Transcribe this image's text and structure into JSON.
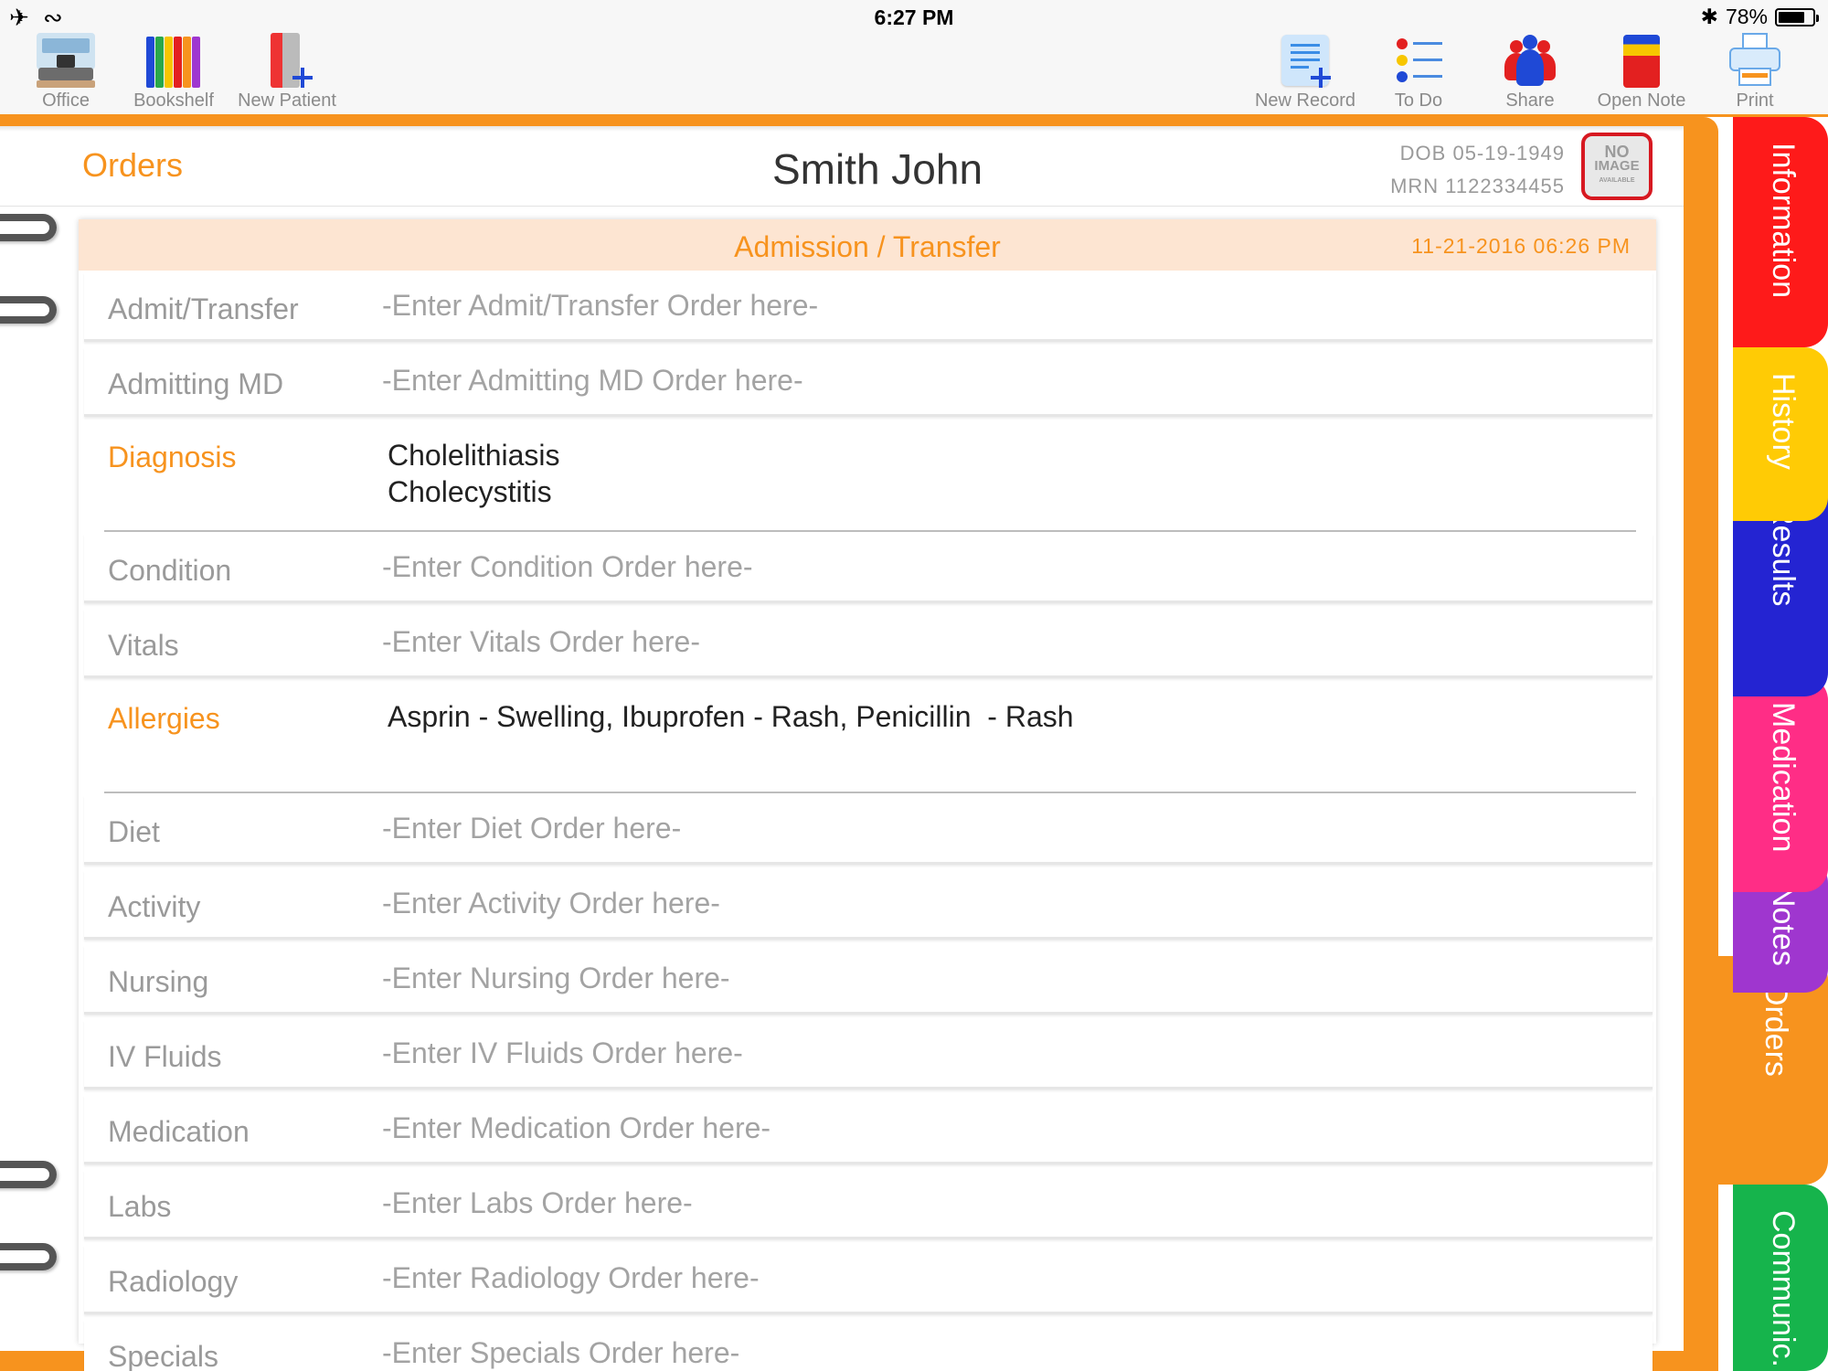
{
  "status_bar": {
    "airplane_icon": "airplane-icon",
    "wifi_icon": "wifi-icon",
    "time": "6:27 PM",
    "bluetooth_icon": "bluetooth-icon",
    "battery": "78%",
    "battery_level": 0.78
  },
  "toolbar": {
    "left": [
      {
        "label": "Office",
        "icon": "office-icon"
      },
      {
        "label": "Bookshelf",
        "icon": "bookshelf-icon"
      },
      {
        "label": "New Patient",
        "icon": "new-patient-icon"
      }
    ],
    "right": [
      {
        "label": "New Record",
        "icon": "new-record-icon"
      },
      {
        "label": "To Do",
        "icon": "todo-list-icon"
      },
      {
        "label": "Share",
        "icon": "share-people-icon"
      },
      {
        "label": "Open Note",
        "icon": "open-note-icon"
      },
      {
        "label": "Print",
        "icon": "printer-icon"
      }
    ]
  },
  "header": {
    "section": "Orders",
    "patient_name": "Smith John",
    "dob": "DOB 05-19-1949",
    "mrn": "MRN 1122334455",
    "photo": {
      "line1": "NO",
      "line2": "IMAGE",
      "line3": "AVAILABLE"
    }
  },
  "form": {
    "title": "Admission / Transfer",
    "date": "11-21-2016 06:26 PM",
    "rows": [
      {
        "label": "Admit/Transfer",
        "value": "-Enter Admit/Transfer Order here-",
        "filled": false
      },
      {
        "label": "Admitting MD",
        "value": "-Enter Admitting MD Order here-",
        "filled": false
      },
      {
        "label": "Diagnosis",
        "value": "Cholelithiasis\nCholecystitis",
        "filled": true
      },
      {
        "label": "Condition",
        "value": "-Enter Condition Order here-",
        "filled": false
      },
      {
        "label": "Vitals",
        "value": "-Enter Vitals Order here-",
        "filled": false
      },
      {
        "label": "Allergies",
        "value": "Asprin - Swelling, Ibuprofen - Rash, Penicillin  - Rash",
        "filled": true
      },
      {
        "label": "Diet",
        "value": "-Enter Diet Order here-",
        "filled": false
      },
      {
        "label": "Activity",
        "value": "-Enter Activity Order here-",
        "filled": false
      },
      {
        "label": "Nursing",
        "value": "-Enter Nursing Order here-",
        "filled": false
      },
      {
        "label": "IV Fluids",
        "value": "-Enter IV Fluids Order here-",
        "filled": false
      },
      {
        "label": "Medication",
        "value": "-Enter Medication Order here-",
        "filled": false
      },
      {
        "label": "Labs",
        "value": "-Enter Labs Order here-",
        "filled": false
      },
      {
        "label": "Radiology",
        "value": "-Enter Radiology Order here-",
        "filled": false
      },
      {
        "label": "Specials",
        "value": "-Enter Specials Order here-",
        "filled": false
      }
    ]
  },
  "tabs": [
    {
      "label": "Information",
      "color": "#fe1a1a",
      "text_color": "#ffffff"
    },
    {
      "label": "History",
      "color": "#ffcb05",
      "text_color": "#ffffff"
    },
    {
      "label": "Results",
      "color": "#2424d2",
      "text_color": "#ffffff"
    },
    {
      "label": "Medication",
      "color": "#ff2d86",
      "text_color": "#ffffff"
    },
    {
      "label": "Notes",
      "color": "#9f36cf",
      "text_color": "#ffffff"
    },
    {
      "label": "Orders",
      "color": "#f7931e",
      "text_color": "#ffffff",
      "active": true
    },
    {
      "label": "Communic.",
      "color": "#16b44c",
      "text_color": "#ffffff"
    }
  ],
  "colors": {
    "accent": "#f7931e",
    "form_header_bg": "#fde5d2",
    "photo_border": "#d71921"
  }
}
